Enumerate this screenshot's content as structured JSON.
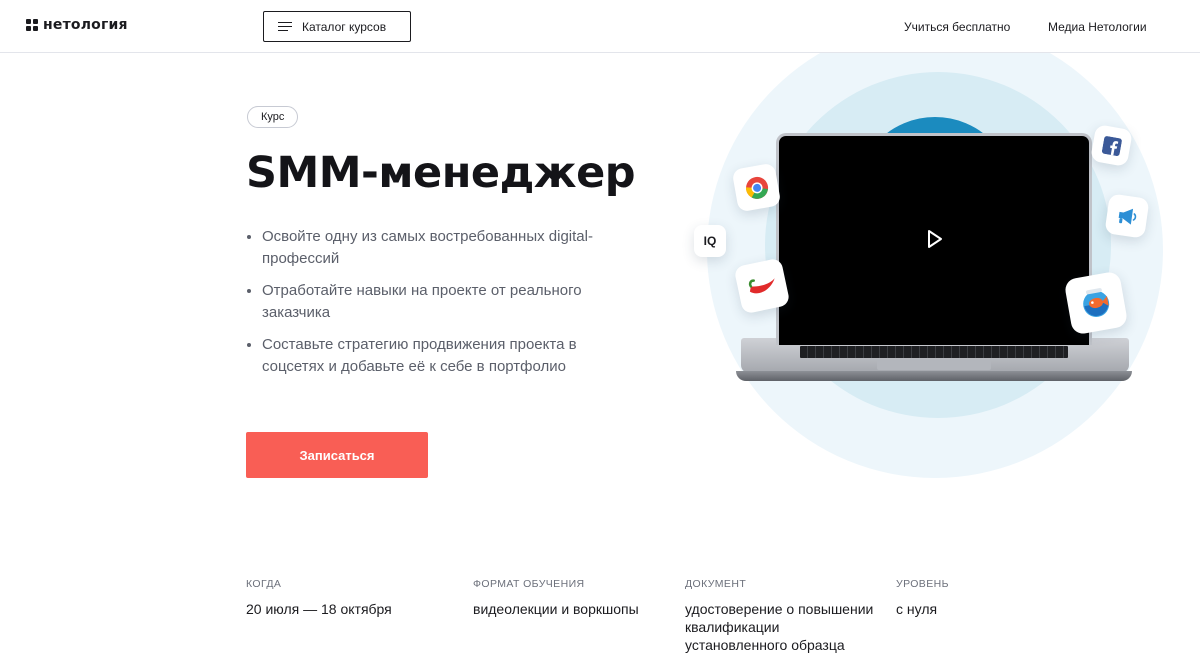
{
  "header": {
    "logo": "нетология",
    "catalog_label": "Каталог курсов",
    "nav": [
      "Учиться бесплатно",
      "Медиа Нетологии"
    ]
  },
  "hero": {
    "badge": "Курс",
    "title": "SMM-менеджер",
    "bullets": [
      "Освойте одну из самых востребованных digital-профессий",
      "Отработайте навыки на проекте от реального заказчика",
      "Составьте стратегию продвижения проекта в соцсетях и добавьте её к себе в портфолио"
    ],
    "cta": "Записаться",
    "accent_color": "#f95e55"
  },
  "illustration": {
    "icons": [
      "chrome-icon",
      "io-icon",
      "chili-icon",
      "facebook-icon",
      "megaphone-icon",
      "fish-bowl-icon",
      "play-icon"
    ],
    "io_text": "IQ"
  },
  "facts": [
    {
      "label": "Когда",
      "value": "20 июля — 18 октября"
    },
    {
      "label": "Формат обучения",
      "value": "видеолекции и воркшопы"
    },
    {
      "label": "Документ",
      "value": "удостоверение о повышении квалификации установленного образца"
    },
    {
      "label": "Уровень",
      "value": "с нуля"
    }
  ]
}
